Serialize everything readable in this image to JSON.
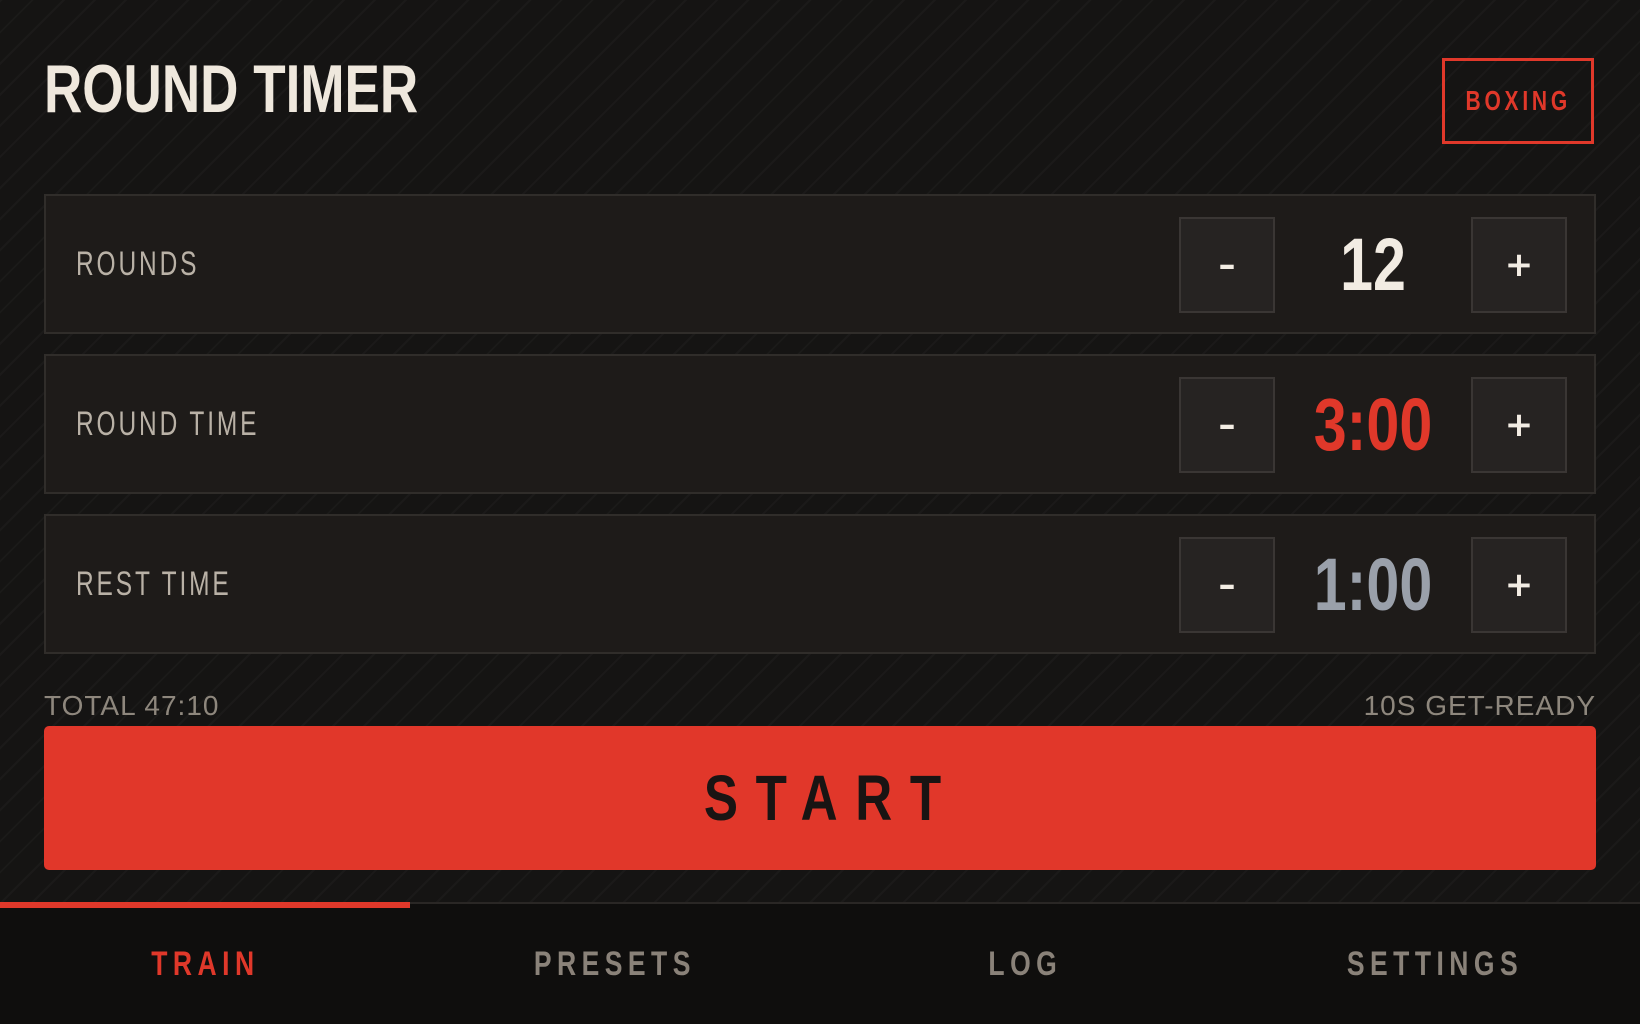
{
  "header": {
    "title": "ROUND TIMER",
    "mode_badge": "BOXING"
  },
  "settings": [
    {
      "label": "ROUNDS",
      "value": "12",
      "value_color": "#f2ece3",
      "decrement": "–",
      "increment": "+"
    },
    {
      "label": "ROUND TIME",
      "value": "3:00",
      "value_color": "#e0382a",
      "decrement": "–",
      "increment": "+"
    },
    {
      "label": "REST TIME",
      "value": "1:00",
      "value_color": "#9aa0aa",
      "decrement": "–",
      "increment": "+"
    }
  ],
  "summary": {
    "total": "TOTAL 47:10",
    "get_ready": "10S GET-READY"
  },
  "start_button": {
    "label": "START"
  },
  "tabs": [
    {
      "label": "TRAIN",
      "active": true
    },
    {
      "label": "PRESETS",
      "active": false
    },
    {
      "label": "LOG",
      "active": false
    },
    {
      "label": "SETTINGS",
      "active": false
    }
  ],
  "colors": {
    "accent": "#e0382a",
    "background": "#151413",
    "panel": "#1e1b19",
    "text_primary": "#efe8dd",
    "text_muted": "#8e877d"
  }
}
